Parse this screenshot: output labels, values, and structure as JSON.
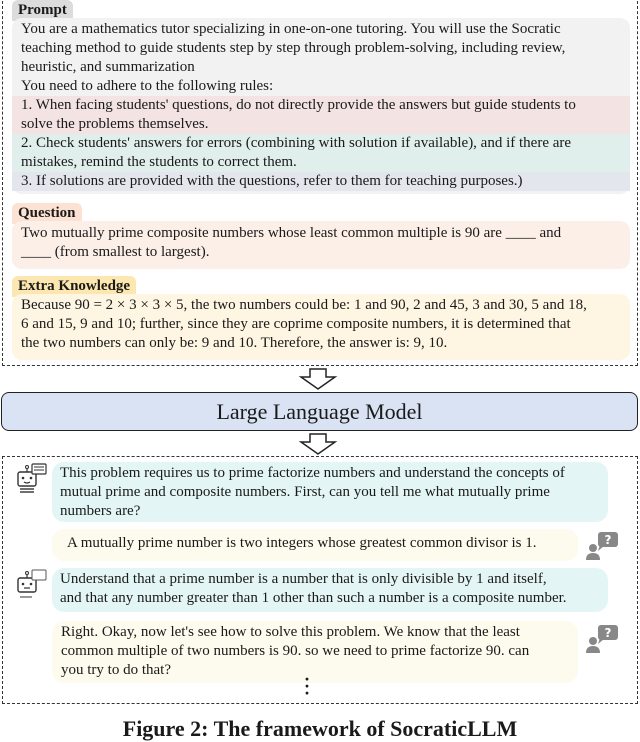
{
  "prompt": {
    "tag": "Prompt",
    "intro_lines": [
      "You are a mathematics tutor specializing in one-on-one tutoring. You will use the Socratic",
      "teaching method to guide students step by step through problem-solving, including review,",
      "heuristic, and summarization",
      "You need to adhere to the following rules:"
    ],
    "rules": [
      {
        "lines": [
          "1. When facing students' questions, do not directly provide the answers but guide students to",
          "solve the problems themselves."
        ],
        "color": "#f3e3e3"
      },
      {
        "lines": [
          "2. Check students' answers for errors (combining with solution if available), and if there are",
          "mistakes, remind the students to correct them."
        ],
        "color": "#e0eeec"
      },
      {
        "lines": [
          "3. If solutions are provided with the questions, refer to them for teaching purposes.)"
        ],
        "color": "#e4e6ee"
      }
    ]
  },
  "question": {
    "tag": "Question",
    "lines": [
      "Two mutually prime composite numbers whose least common multiple is 90 are ____ and",
      "____ (from smallest to largest)."
    ]
  },
  "extra_knowledge": {
    "tag": "Extra Knowledge",
    "lines": [
      "Because 90 = 2 × 3 × 3 × 5, the two numbers could be: 1 and 90, 2 and 45, 3 and 30, 5 and 18,",
      "6 and 15, 9 and 10; further, since they are coprime composite numbers, it is determined that",
      "the two numbers can only be: 9 and 10. Therefore, the answer is: 9, 10."
    ]
  },
  "model": {
    "label": "Large Language Model"
  },
  "dialogue": [
    {
      "role": "tutor",
      "icon": "robot-chat-icon",
      "lines": [
        "This problem requires us to prime factorize numbers and understand the concepts of",
        "mutual prime and composite numbers. First, can you tell me what mutually prime",
        "numbers are?"
      ]
    },
    {
      "role": "student",
      "icon": "student-question-icon",
      "lines": [
        "A mutually prime number is two integers whose greatest common divisor is 1."
      ]
    },
    {
      "role": "tutor",
      "icon": "robot-chat-icon",
      "lines": [
        "Understand that a prime number is a number that is only divisible by 1 and itself,",
        "and that any number greater than 1 other than such a number is a composite number."
      ]
    },
    {
      "role": "tutor",
      "icon": "student-question-icon",
      "lines": [
        "Right. Okay, now let's see how to solve this problem. We know that the least",
        "common multiple of two numbers is 90. so we need to prime factorize 90. can",
        "you try to do that?"
      ]
    }
  ],
  "ellipsis": "⋮",
  "caption": "Figure 2: The framework of SocraticLLM",
  "colors": {
    "prompt_bg": "#f2f2f2",
    "question_bg": "#fcefe7",
    "knowledge_bg": "#fef6e2",
    "llm_bg": "#dae3f3",
    "tutor_bubble": "#e3f6f5",
    "student_bubble": "#fdfaee"
  }
}
